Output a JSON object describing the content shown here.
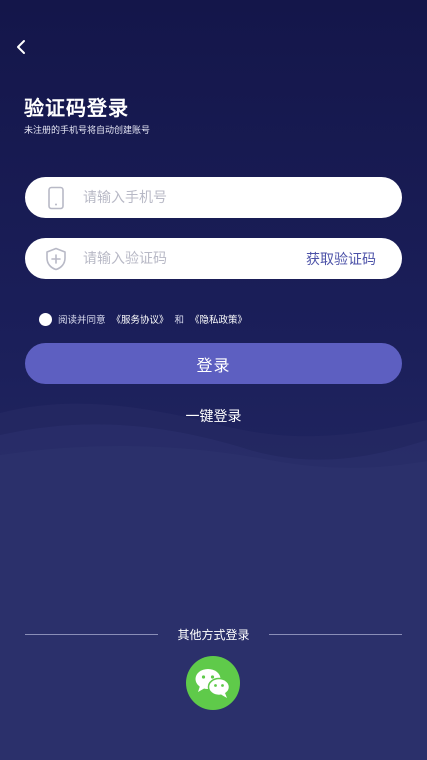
{
  "header": {
    "back_icon": "chevron-left-icon",
    "title": "验证码登录",
    "subtitle": "未注册的手机号将自动创建账号"
  },
  "form": {
    "phone": {
      "placeholder": "请输入手机号",
      "icon": "phone-icon"
    },
    "code": {
      "placeholder": "请输入验证码",
      "icon": "shield-icon",
      "get_code_label": "获取验证码"
    }
  },
  "agreement": {
    "prefix": "阅读并同意",
    "service_link": "《服务协议》",
    "conjunction": "和",
    "privacy_link": "《隐私政策》"
  },
  "login_button": "登录",
  "one_key_login": "一键登录",
  "other_methods": {
    "label": "其他方式登录",
    "wechat_icon": "wechat-icon"
  },
  "colors": {
    "background": "#1b1f5a",
    "button": "#5d5fc1",
    "link": "#4c52a8",
    "wechat": "#5fca4a"
  }
}
